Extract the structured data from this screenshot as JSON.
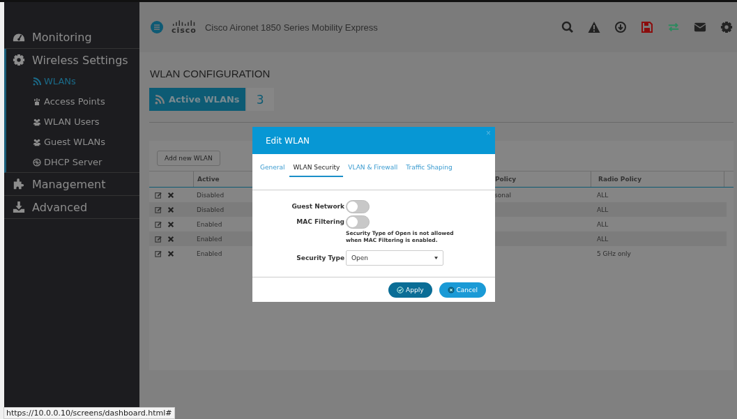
{
  "sidebar": {
    "items": [
      {
        "label": "Monitoring",
        "expanded": false
      },
      {
        "label": "Wireless Settings",
        "expanded": true,
        "children": [
          {
            "label": "WLANs",
            "selected": true
          },
          {
            "label": "Access Points",
            "selected": false
          },
          {
            "label": "WLAN Users",
            "selected": false
          },
          {
            "label": "Guest WLANs",
            "selected": false
          },
          {
            "label": "DHCP Server",
            "selected": false
          }
        ]
      },
      {
        "label": "Management",
        "expanded": false
      },
      {
        "label": "Advanced",
        "expanded": false
      }
    ]
  },
  "header": {
    "logo": "cisco",
    "title": "Cisco Aironet 1850 Series Mobility Express"
  },
  "page_title": "WLAN CONFIGURATION",
  "active_wlans": {
    "label": "Active WLANs",
    "count": "3"
  },
  "add_button": "Add new WLAN",
  "table": {
    "columns": [
      "Active",
      "Policy",
      "Radio Policy"
    ],
    "rows": [
      {
        "active": "Disabled",
        "policy": "sonal",
        "radio": "ALL"
      },
      {
        "active": "Disabled",
        "radio": "ALL"
      },
      {
        "active": "Enabled",
        "radio": "ALL"
      },
      {
        "active": "Enabled",
        "radio": "ALL"
      },
      {
        "active": "Enabled",
        "radio": "5 GHz only"
      }
    ]
  },
  "modal": {
    "title": "Edit WLAN",
    "close": "×",
    "tabs": [
      {
        "label": "General",
        "selected": false
      },
      {
        "label": "WLAN Security",
        "selected": true
      },
      {
        "label": "VLAN & Firewall",
        "selected": false
      },
      {
        "label": "Traffic Shaping",
        "selected": false
      }
    ],
    "guest_network": {
      "label": "Guest Network",
      "on": false
    },
    "mac_filtering": {
      "label": "MAC Filtering",
      "on": false
    },
    "note": "Security Type of Open is not allowed when MAC Filtering is enabled.",
    "security_type": {
      "label": "Security Type",
      "value": "Open"
    },
    "buttons": [
      {
        "kind": "apply",
        "label": "Apply"
      },
      {
        "kind": "cancel",
        "label": "Cancel"
      }
    ]
  },
  "status_url": "https://10.0.0.10/screens/dashboard.html#"
}
